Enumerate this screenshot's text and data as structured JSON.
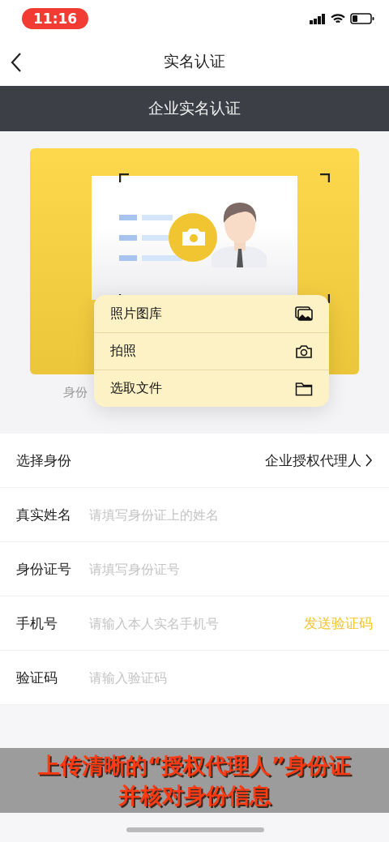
{
  "status_bar": {
    "time": "11:16"
  },
  "nav": {
    "title": "实名认证"
  },
  "banner": {
    "title": "企业实名认证"
  },
  "upload": {
    "caption": "身份"
  },
  "menu": {
    "items": [
      {
        "label": "照片图库",
        "kind": "gallery"
      },
      {
        "label": "拍照",
        "kind": "camera"
      },
      {
        "label": "选取文件",
        "kind": "folder"
      }
    ]
  },
  "form": {
    "rows": [
      {
        "label": "选择身份",
        "kind": "select",
        "value": "企业授权代理人"
      },
      {
        "label": "真实姓名",
        "kind": "input",
        "placeholder": "请填写身份证上的姓名"
      },
      {
        "label": "身份证号",
        "kind": "input",
        "placeholder": "请填写身份证号"
      },
      {
        "label": "手机号",
        "kind": "input",
        "placeholder": "请输入本人实名手机号",
        "action": "发送验证码"
      },
      {
        "label": "验证码",
        "kind": "input",
        "placeholder": "请输入验证码"
      }
    ]
  },
  "caption_overlay": {
    "lines": [
      "上传清晰的“授权代理人”身份证",
      "并核对身份信息"
    ]
  }
}
